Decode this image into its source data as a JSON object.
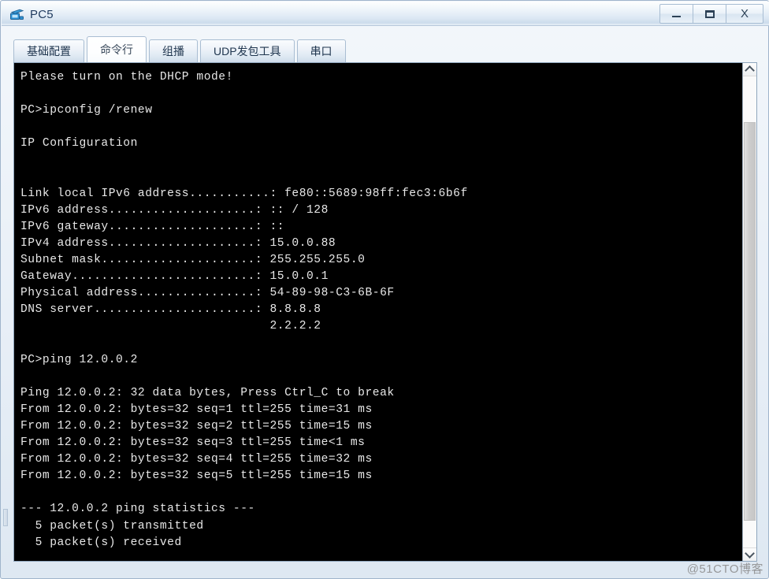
{
  "window": {
    "title": "PC5",
    "icon": "device-pc-icon",
    "controls": {
      "minimize": "–",
      "maximize": "☐",
      "close": "X"
    },
    "colors": {
      "titlebar_top": "#fdfefe",
      "titlebar_bottom": "#ccdcec",
      "frame_border": "#9fb4cb",
      "terminal_bg": "#000000",
      "terminal_fg": "#e8e8e8"
    }
  },
  "tabs": [
    {
      "label": "基础配置",
      "active": false
    },
    {
      "label": "命令行",
      "active": true
    },
    {
      "label": "组播",
      "active": false
    },
    {
      "label": "UDP发包工具",
      "active": false
    },
    {
      "label": "串口",
      "active": false
    }
  ],
  "terminal": {
    "lines": [
      "Please turn on the DHCP mode!",
      "",
      "PC>ipconfig /renew",
      "",
      "IP Configuration",
      "",
      "",
      "Link local IPv6 address...........: fe80::5689:98ff:fec3:6b6f",
      "IPv6 address....................: :: / 128",
      "IPv6 gateway....................: ::",
      "IPv4 address....................: 15.0.0.88",
      "Subnet mask.....................: 255.255.255.0",
      "Gateway.........................: 15.0.0.1",
      "Physical address................: 54-89-98-C3-6B-6F",
      "DNS server......................: 8.8.8.8",
      "                                  2.2.2.2",
      "",
      "PC>ping 12.0.0.2",
      "",
      "Ping 12.0.0.2: 32 data bytes, Press Ctrl_C to break",
      "From 12.0.0.2: bytes=32 seq=1 ttl=255 time=31 ms",
      "From 12.0.0.2: bytes=32 seq=2 ttl=255 time=15 ms",
      "From 12.0.0.2: bytes=32 seq=3 ttl=255 time<1 ms",
      "From 12.0.0.2: bytes=32 seq=4 ttl=255 time=32 ms",
      "From 12.0.0.2: bytes=32 seq=5 ttl=255 time=15 ms",
      "",
      "--- 12.0.0.2 ping statistics ---",
      "  5 packet(s) transmitted",
      "  5 packet(s) received"
    ]
  },
  "scrollbar": {
    "up_arrow": "scroll-up-icon",
    "down_arrow": "scroll-down-icon"
  },
  "watermark": {
    "text": "@51CTO博客"
  }
}
